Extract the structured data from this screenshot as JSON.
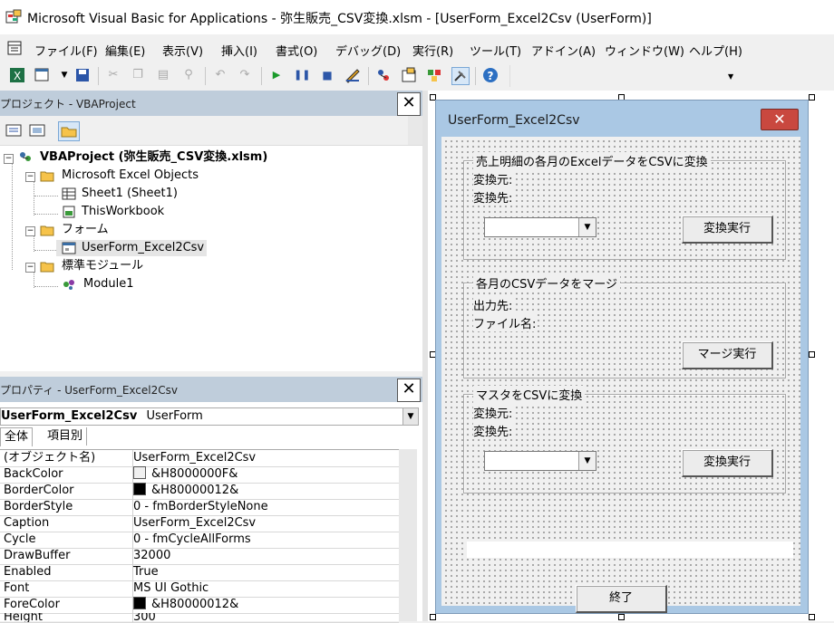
{
  "window": {
    "title": "Microsoft Visual Basic for Applications - 弥生販売_CSV変換.xlsm - [UserForm_Excel2Csv (UserForm)]"
  },
  "menu": [
    {
      "id": "file",
      "label": "ファイル(F)"
    },
    {
      "id": "edit",
      "label": "編集(E)"
    },
    {
      "id": "view",
      "label": "表示(V)"
    },
    {
      "id": "insert",
      "label": "挿入(I)"
    },
    {
      "id": "format",
      "label": "書式(O)"
    },
    {
      "id": "debug",
      "label": "デバッグ(D)"
    },
    {
      "id": "run",
      "label": "実行(R)"
    },
    {
      "id": "tools",
      "label": "ツール(T)"
    },
    {
      "id": "addins",
      "label": "アドイン(A)"
    },
    {
      "id": "window",
      "label": "ウィンドウ(W)"
    },
    {
      "id": "help",
      "label": "ヘルプ(H)"
    }
  ],
  "project": {
    "title": "プロジェクト - VBAProject",
    "tree": {
      "root": "VBAProject (弥生販売_CSV変換.xlsm)",
      "excel_objects": "Microsoft Excel Objects",
      "sheet1": "Sheet1 (Sheet1)",
      "thisworkbook": "ThisWorkbook",
      "forms": "フォーム",
      "userform": "UserForm_Excel2Csv",
      "modules": "標準モジュール",
      "module1": "Module1"
    }
  },
  "properties": {
    "title": "プロパティ - UserForm_Excel2Csv",
    "object_name": "UserForm_Excel2Csv",
    "object_type": "UserForm",
    "tab_all": "全体",
    "tab_category": "項目別",
    "rows": [
      {
        "name": "(オブジェクト名)",
        "value": "UserForm_Excel2Csv"
      },
      {
        "name": "BackColor",
        "value": "&H8000000F&",
        "swatch": "#f0f0f0"
      },
      {
        "name": "BorderColor",
        "value": "&H80000012&",
        "swatch": "#000000"
      },
      {
        "name": "BorderStyle",
        "value": "0 - fmBorderStyleNone"
      },
      {
        "name": "Caption",
        "value": "UserForm_Excel2Csv"
      },
      {
        "name": "Cycle",
        "value": "0 - fmCycleAllForms"
      },
      {
        "name": "DrawBuffer",
        "value": "32000"
      },
      {
        "name": "Enabled",
        "value": "True"
      },
      {
        "name": "Font",
        "value": "MS UI Gothic"
      },
      {
        "name": "ForeColor",
        "value": "&H80000012&",
        "swatch": "#000000"
      },
      {
        "name": "Height",
        "value": "300"
      }
    ]
  },
  "form": {
    "caption": "UserForm_Excel2Csv",
    "close_glyph": "✕",
    "frame1": {
      "title": "売上明細の各月のExcelデータをCSVに変換",
      "label_src": "変換元:",
      "label_dst": "変換先:",
      "button": "変換実行"
    },
    "frame2": {
      "title": "各月のCSVデータをマージ",
      "label_out": "出力先:",
      "label_file": "ファイル名:",
      "button": "マージ実行"
    },
    "frame3": {
      "title": "マスタをCSVに変換",
      "label_src": "変換元:",
      "label_dst": "変換先:",
      "button": "変換実行"
    },
    "exit_button": "終了"
  }
}
